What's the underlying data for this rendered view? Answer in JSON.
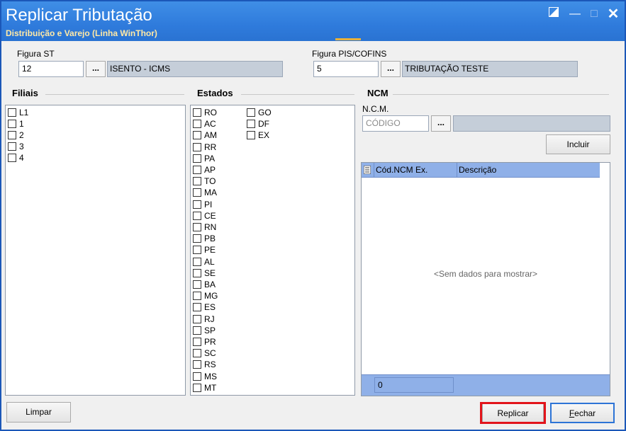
{
  "window": {
    "title": "Replicar Tributação",
    "subtitle": "Distribuição e Varejo (Linha WinThor)"
  },
  "figura_st": {
    "label": "Figura ST",
    "code": "12",
    "dots": "...",
    "description": "ISENTO - ICMS"
  },
  "figura_pis": {
    "label": "Figura PIS/COFINS",
    "code": "5",
    "dots": "...",
    "description": "TRIBUTAÇÃO TESTE"
  },
  "filiais": {
    "title": "Filiais",
    "items": [
      "L1",
      "1",
      "2",
      "3",
      "4"
    ]
  },
  "estados": {
    "title": "Estados",
    "col1": [
      "RO",
      "AC",
      "AM",
      "RR",
      "PA",
      "AP",
      "TO",
      "MA",
      "PI",
      "CE",
      "RN",
      "PB",
      "PE",
      "AL",
      "SE",
      "BA",
      "MG",
      "ES",
      "RJ",
      "SP",
      "PR",
      "SC",
      "RS",
      "MS",
      "MT"
    ],
    "col2": [
      "GO",
      "DF",
      "EX"
    ]
  },
  "ncm": {
    "title": "NCM",
    "field_label": "N.C.M.",
    "placeholder": "CÓDIGO",
    "dots": "...",
    "include_label": "Incluir",
    "grid": {
      "columns": [
        "Cód.NCM Ex.",
        "Descrição"
      ],
      "empty_text": "<Sem dados para mostrar>",
      "footer_value": "0"
    }
  },
  "buttons": {
    "clear": "Limpar",
    "replicate": "Replicar",
    "close": "Fechar"
  },
  "colors": {
    "titlebar": "#2f7bdc",
    "accent_red": "#e2141b",
    "grid_header": "#8fb0e8"
  }
}
